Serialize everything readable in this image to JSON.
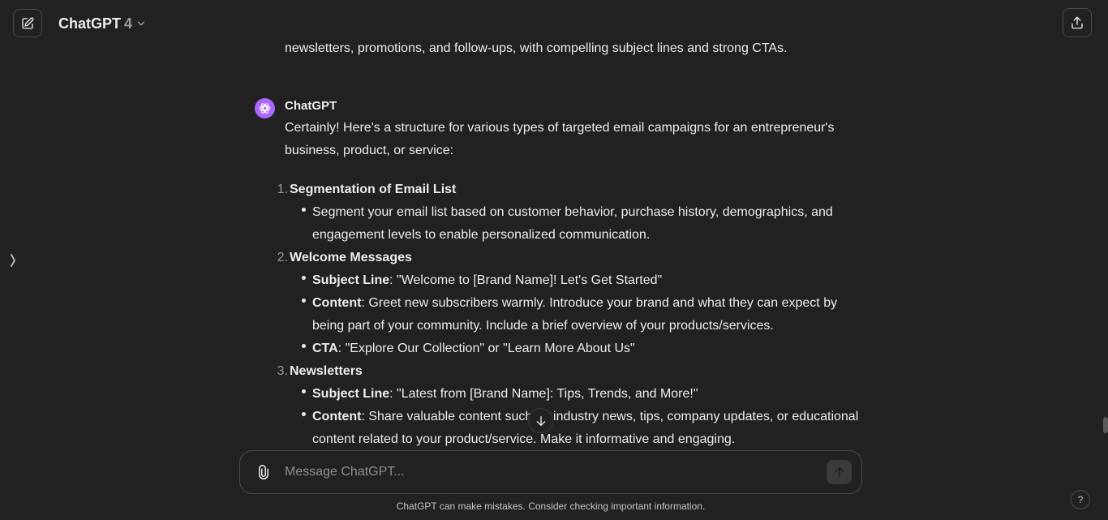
{
  "header": {
    "model_name": "ChatGPT",
    "model_version": "4"
  },
  "conversation": {
    "previous_text": "newsletters, promotions, and follow-ups, with compelling subject lines and strong CTAs.",
    "assistant": {
      "author": "ChatGPT",
      "intro": "Certainly! Here's a structure for various types of targeted email campaigns for an entrepreneur's business, product, or service:",
      "sections": [
        {
          "number": "1.",
          "title": "Segmentation of Email List",
          "bullets": [
            {
              "label": "",
              "text": "Segment your email list based on customer behavior, purchase history, demographics, and engagement levels to enable personalized communication."
            }
          ]
        },
        {
          "number": "2.",
          "title": "Welcome Messages",
          "bullets": [
            {
              "label": "Subject Line",
              "text": ": \"Welcome to [Brand Name]! Let's Get Started\""
            },
            {
              "label": "Content",
              "text": ": Greet new subscribers warmly. Introduce your brand and what they can expect by being part of your community. Include a brief overview of your products/services."
            },
            {
              "label": "CTA",
              "text": ": \"Explore Our Collection\" or \"Learn More About Us\""
            }
          ]
        },
        {
          "number": "3.",
          "title": "Newsletters",
          "bullets": [
            {
              "label": "Subject Line",
              "text": ": \"Latest from [Brand Name]: Tips, Trends, and More!\""
            },
            {
              "label": "Content",
              "text": ": Share valuable content such as industry news, tips, company updates, or educational content related to your product/service. Make it informative and engaging."
            }
          ]
        }
      ]
    }
  },
  "composer": {
    "placeholder": "Message ChatGPT..."
  },
  "footer": {
    "disclaimer": "ChatGPT can make mistakes. Consider checking important information.",
    "help_label": "?"
  },
  "icons": {
    "new_chat": "pencil-square-icon",
    "model_dropdown": "chevron-down-icon",
    "share": "share-icon",
    "sidebar_toggle": "chevron-right-icon",
    "avatar": "openai-logo-icon",
    "scroll_down": "arrow-down-icon",
    "attach": "paperclip-icon",
    "send": "arrow-up-icon"
  },
  "colors": {
    "background": "#212121",
    "text": "#ececec",
    "avatar": "#ab68ff"
  }
}
